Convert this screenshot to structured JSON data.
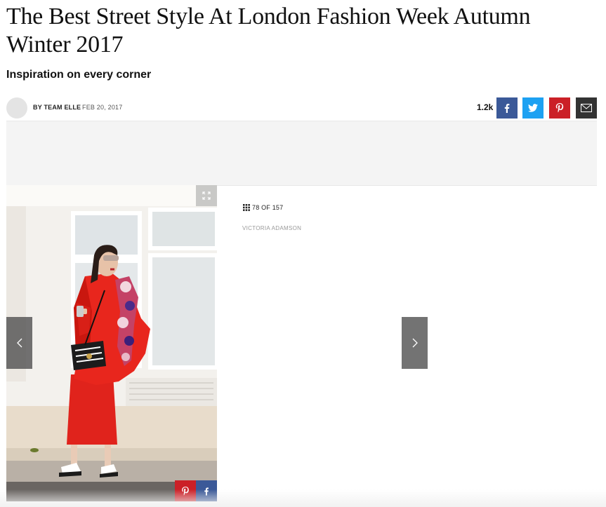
{
  "article": {
    "title": "The Best Street Style At London Fashion Week Autumn Winter 2017",
    "subtitle": "Inspiration on every corner",
    "author": "BY TEAM ELLE",
    "date": "FEB 20, 2017"
  },
  "share": {
    "count": "1.2k",
    "buttons": [
      {
        "name": "facebook",
        "icon": "facebook-icon",
        "color": "#3b5998"
      },
      {
        "name": "twitter",
        "icon": "twitter-icon",
        "color": "#1da1f2"
      },
      {
        "name": "pinterest",
        "icon": "pinterest-icon",
        "color": "#cb2027"
      },
      {
        "name": "email",
        "icon": "mail-icon",
        "color": "#333333"
      }
    ]
  },
  "gallery": {
    "counter": "78 OF 157",
    "credit": "VICTORIA ADAMSON",
    "photo_alt": "Woman in red coat and red midi skirt with fur stole and black quilted shoulder bag",
    "icons": {
      "expand": "expand-icon",
      "prev": "chevron-left-icon",
      "next": "chevron-right-icon",
      "grid": "grid-icon"
    }
  }
}
